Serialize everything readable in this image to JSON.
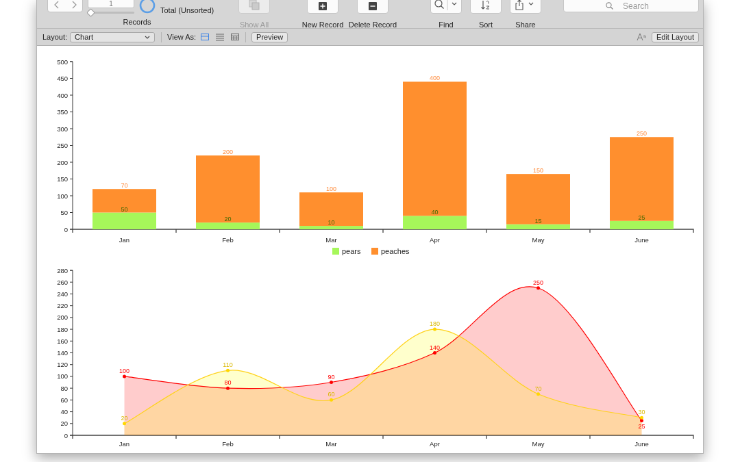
{
  "toolbar": {
    "record_field": "1",
    "record_status": "Total (Unsorted)",
    "records_label": "Records",
    "buttons": [
      {
        "kind": "show_all",
        "label": "Show All",
        "disabled": true
      },
      {
        "kind": "new_record",
        "label": "New Record",
        "disabled": false
      },
      {
        "kind": "delete_record",
        "label": "Delete Record",
        "disabled": false
      },
      {
        "kind": "find",
        "label": "Find",
        "disabled": false
      },
      {
        "kind": "sort",
        "label": "Sort",
        "disabled": false
      },
      {
        "kind": "share",
        "label": "Share",
        "disabled": false
      }
    ],
    "slider": {
      "level": 0
    },
    "search": {
      "placeholder": "Search"
    }
  },
  "layout_bar": {
    "layout_label": "Layout:",
    "layout_value": "Chart",
    "view_as_label": "View As:",
    "view_modes": [
      {
        "kind": "form",
        "selected": true
      },
      {
        "kind": "list",
        "selected": false
      },
      {
        "kind": "table",
        "selected": false
      }
    ],
    "preview_button": "Preview",
    "edit_layout_button": "Edit Layout"
  },
  "charts": [
    {
      "chart_data": {
        "type": "bar",
        "stacked": true,
        "data_labels": true,
        "legend": true,
        "categories": [
          "Jan",
          "Feb",
          "Mar",
          "Apr",
          "May",
          "June"
        ],
        "ylim": [
          0,
          500
        ],
        "yticks": [
          0,
          50,
          100,
          150,
          200,
          250,
          300,
          350,
          400,
          450,
          500
        ],
        "series": [
          {
            "name": "pears",
            "color": "#a6f75a",
            "values": [
              50,
              20,
              10,
              40,
              15,
              25
            ]
          },
          {
            "name": "peaches",
            "color": "#ff8f2e",
            "values": [
              70,
              200,
              100,
              400,
              150,
              250
            ]
          }
        ]
      }
    },
    {
      "chart_data": {
        "type": "area",
        "data_labels": true,
        "categories": [
          "Jan",
          "Feb",
          "Mar",
          "Apr",
          "May",
          "June"
        ],
        "ylim": [
          0,
          280
        ],
        "yticks": [
          0,
          20,
          40,
          60,
          80,
          100,
          120,
          140,
          160,
          180,
          200,
          220,
          240,
          260,
          280
        ],
        "series": [
          {
            "color": "#ff0000",
            "values": [
              100,
              80,
              90,
              140,
              250,
              25
            ]
          },
          {
            "color": "#ffff00",
            "values": [
              20,
              110,
              60,
              180,
              70,
              30
            ]
          }
        ]
      }
    }
  ]
}
